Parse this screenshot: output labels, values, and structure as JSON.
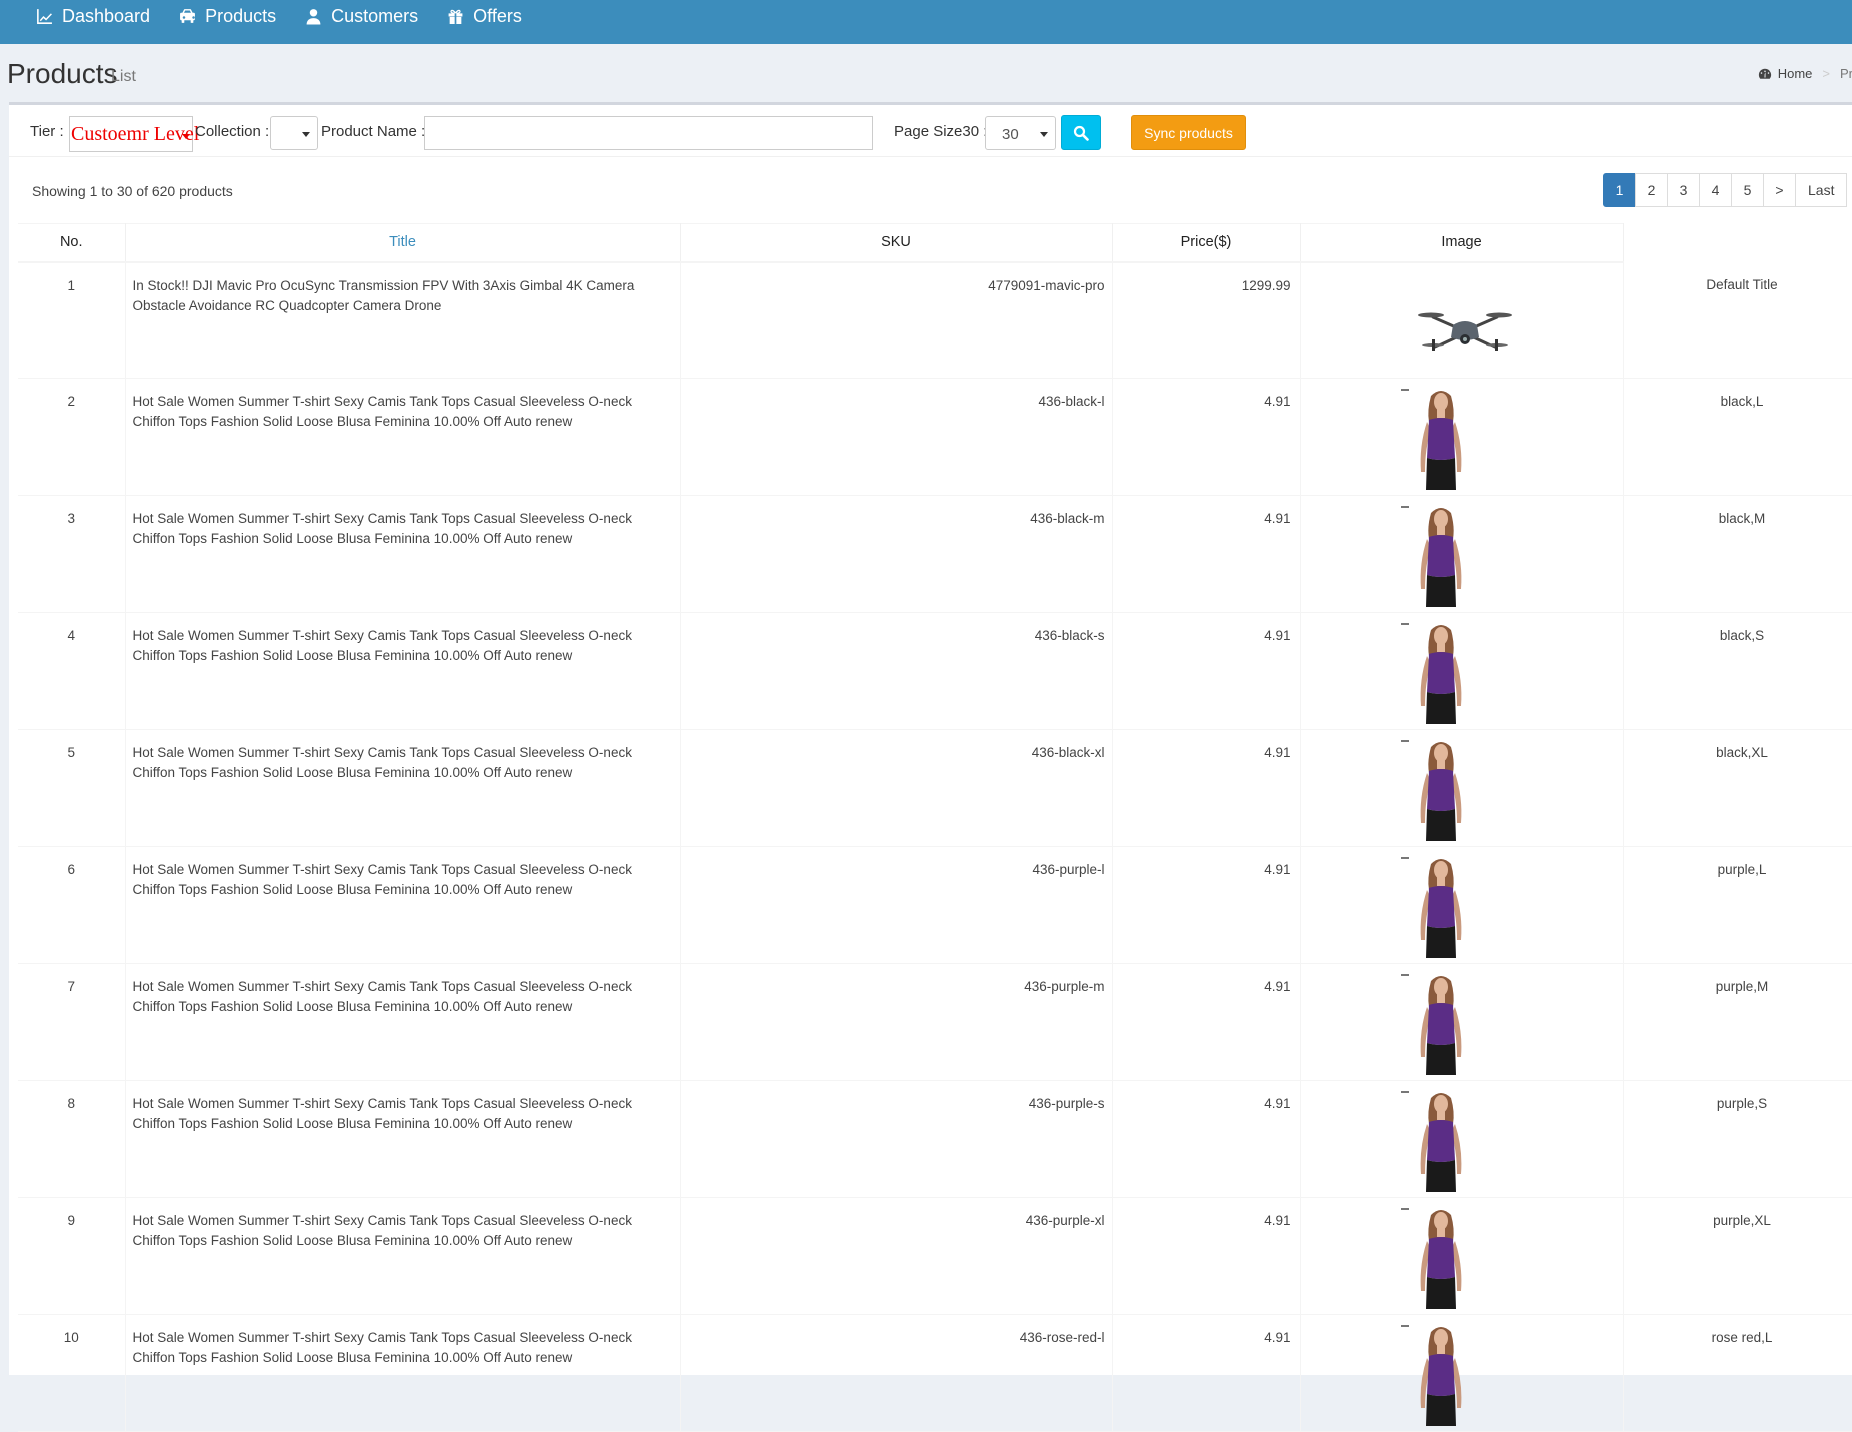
{
  "nav": {
    "items": [
      {
        "label": "Dashboard",
        "icon": "chart-icon"
      },
      {
        "label": "Products",
        "icon": "car-icon"
      },
      {
        "label": "Customers",
        "icon": "user-icon"
      },
      {
        "label": "Offers",
        "icon": "gift-icon"
      }
    ]
  },
  "header": {
    "title": "Products",
    "subtitle": "List",
    "breadcrumb": [
      "Home",
      "Products"
    ]
  },
  "filters": {
    "tier_label": "Tier :",
    "tier_value": "Custoemr Level",
    "collection_label": "Collection :",
    "collection_value": "",
    "product_name_label": "Product Name :",
    "product_name_value": "",
    "page_size_label": "Page Size30 :",
    "page_size_value": "30",
    "sync_label": "Sync products"
  },
  "summary": "Showing 1 to 30 of 620 products",
  "pagination": [
    "1",
    "2",
    "3",
    "4",
    "5",
    ">",
    "Last"
  ],
  "table": {
    "headers": [
      "No.",
      "Title",
      "SKU",
      "Price($)",
      "Image",
      ""
    ],
    "rows": [
      {
        "no": "1",
        "title": "In Stock!! DJI Mavic Pro OcuSync Transmission FPV With 3Axis Gimbal 4K Camera Obstacle Avoidance RC Quadcopter Camera Drone",
        "sku": "4779091-mavic-pro",
        "price": "1299.99",
        "image": "drone",
        "variant": "Default Title"
      },
      {
        "no": "2",
        "title": "Hot Sale Women Summer T-shirt Sexy Camis Tank Tops Casual Sleeveless O-neck Chiffon Tops Fashion Solid Loose Blusa Feminina 10.00% Off Auto renew",
        "sku": "436-black-l",
        "price": "4.91",
        "image": "tank-top",
        "variant": "black,L"
      },
      {
        "no": "3",
        "title": "Hot Sale Women Summer T-shirt Sexy Camis Tank Tops Casual Sleeveless O-neck Chiffon Tops Fashion Solid Loose Blusa Feminina 10.00% Off Auto renew",
        "sku": "436-black-m",
        "price": "4.91",
        "image": "tank-top",
        "variant": "black,M"
      },
      {
        "no": "4",
        "title": "Hot Sale Women Summer T-shirt Sexy Camis Tank Tops Casual Sleeveless O-neck Chiffon Tops Fashion Solid Loose Blusa Feminina 10.00% Off Auto renew",
        "sku": "436-black-s",
        "price": "4.91",
        "image": "tank-top",
        "variant": "black,S"
      },
      {
        "no": "5",
        "title": "Hot Sale Women Summer T-shirt Sexy Camis Tank Tops Casual Sleeveless O-neck Chiffon Tops Fashion Solid Loose Blusa Feminina 10.00% Off Auto renew",
        "sku": "436-black-xl",
        "price": "4.91",
        "image": "tank-top",
        "variant": "black,XL"
      },
      {
        "no": "6",
        "title": "Hot Sale Women Summer T-shirt Sexy Camis Tank Tops Casual Sleeveless O-neck Chiffon Tops Fashion Solid Loose Blusa Feminina 10.00% Off Auto renew",
        "sku": "436-purple-l",
        "price": "4.91",
        "image": "tank-top",
        "variant": "purple,L"
      },
      {
        "no": "7",
        "title": "Hot Sale Women Summer T-shirt Sexy Camis Tank Tops Casual Sleeveless O-neck Chiffon Tops Fashion Solid Loose Blusa Feminina 10.00% Off Auto renew",
        "sku": "436-purple-m",
        "price": "4.91",
        "image": "tank-top",
        "variant": "purple,M"
      },
      {
        "no": "8",
        "title": "Hot Sale Women Summer T-shirt Sexy Camis Tank Tops Casual Sleeveless O-neck Chiffon Tops Fashion Solid Loose Blusa Feminina 10.00% Off Auto renew",
        "sku": "436-purple-s",
        "price": "4.91",
        "image": "tank-top",
        "variant": "purple,S"
      },
      {
        "no": "9",
        "title": "Hot Sale Women Summer T-shirt Sexy Camis Tank Tops Casual Sleeveless O-neck Chiffon Tops Fashion Solid Loose Blusa Feminina 10.00% Off Auto renew",
        "sku": "436-purple-xl",
        "price": "4.91",
        "image": "tank-top",
        "variant": "purple,XL"
      },
      {
        "no": "10",
        "title": "Hot Sale Women Summer T-shirt Sexy Camis Tank Tops Casual Sleeveless O-neck Chiffon Tops Fashion Solid Loose Blusa Feminina 10.00% Off Auto renew",
        "sku": "436-rose-red-l",
        "price": "4.91",
        "image": "tank-top",
        "variant": "rose red,L"
      }
    ]
  },
  "colors": {
    "nav_bg": "#3c8dbc",
    "search_btn": "#00c0ef",
    "sync_btn": "#f39c12",
    "active_page": "#337ab7",
    "tier_text": "#ee0000"
  }
}
